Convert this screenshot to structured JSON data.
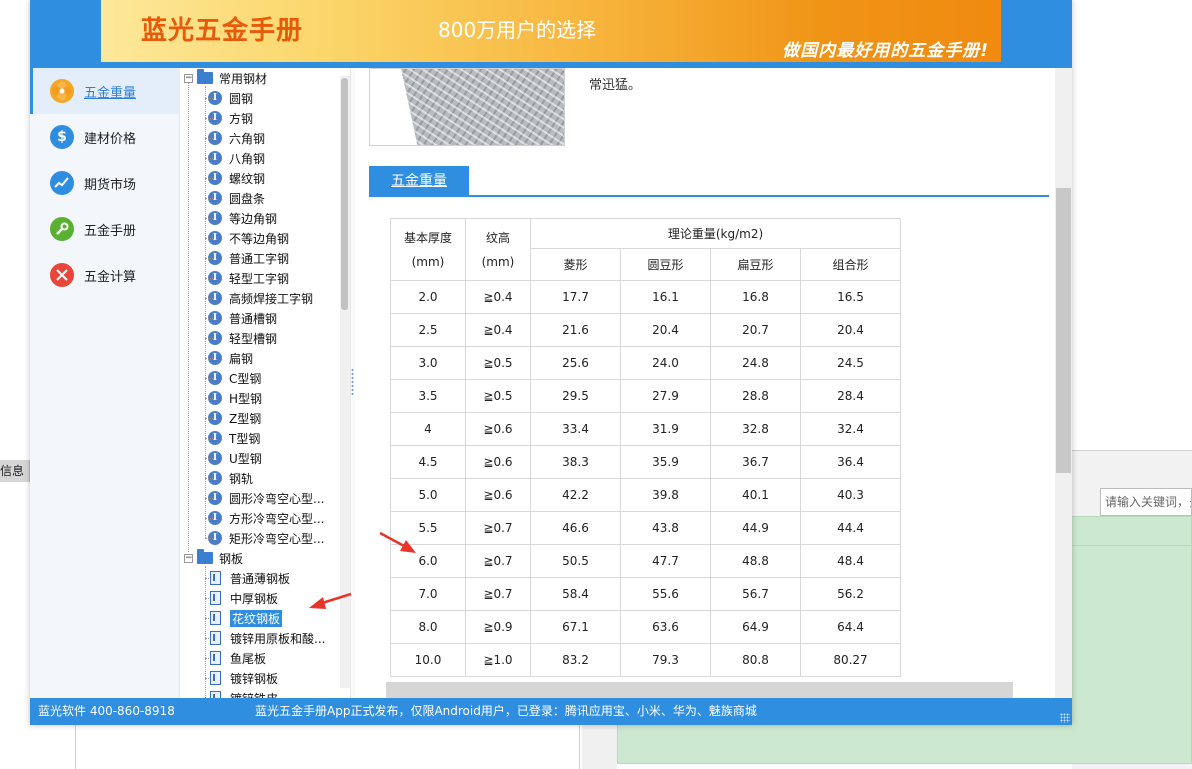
{
  "background": {
    "left_tab_text": "信息",
    "right_search_placeholder": "请输入关键词，多"
  },
  "banner": {
    "title": "蓝光五金手册",
    "subtitle": "800万用户的选择",
    "slogan": "做国内最好用的五金手册!"
  },
  "nav": {
    "items": [
      {
        "label": "五金重量",
        "icon": "flower-icon",
        "color": "#f5a623",
        "active": true
      },
      {
        "label": "建材价格",
        "icon": "dollar-icon",
        "color": "#2f8ee0",
        "active": false
      },
      {
        "label": "期货市场",
        "icon": "trend-chart-icon",
        "color": "#2f8ee0",
        "active": false
      },
      {
        "label": "五金手册",
        "icon": "wrench-icon",
        "color": "#5ab030",
        "active": false
      },
      {
        "label": "五金计算",
        "icon": "tools-icon",
        "color": "#e8463a",
        "active": false
      }
    ]
  },
  "tree": {
    "group1": "常用钢材",
    "group1_items": [
      "圆钢",
      "方钢",
      "六角钢",
      "八角钢",
      "螺纹钢",
      "圆盘条",
      "等边角钢",
      "不等边角钢",
      "普通工字钢",
      "轻型工字钢",
      "高频焊接工字钢",
      "普通槽钢",
      "轻型槽钢",
      "扁钢",
      "C型钢",
      "H型钢",
      "Z型钢",
      "T型钢",
      "U型钢",
      "钢轨",
      "圆形冷弯空心型...",
      "方形冷弯空心型...",
      "矩形冷弯空心型..."
    ],
    "group2": "钢板",
    "group2_items": [
      "普通薄钢板",
      "中厚钢板",
      "花纹钢板",
      "镀锌用原板和酸...",
      "鱼尾板",
      "镀锌钢板",
      "镀锌铁皮"
    ],
    "selected": "花纹钢板"
  },
  "content": {
    "desc_tail": "常迅猛。",
    "section_tab": "五金重量",
    "table": {
      "h_thickness": "基本厚度",
      "h_thickness_unit": "(mm)",
      "h_pattern": "纹高",
      "h_pattern_unit": "(mm)",
      "h_weight": "理论重量(kg/m2)",
      "sub_headers": [
        "菱形",
        "圆豆形",
        "扁豆形",
        "组合形"
      ],
      "rows": [
        [
          "2.0",
          "≧0.4",
          "17.7",
          "16.1",
          "16.8",
          "16.5"
        ],
        [
          "2.5",
          "≧0.4",
          "21.6",
          "20.4",
          "20.7",
          "20.4"
        ],
        [
          "3.0",
          "≧0.5",
          "25.6",
          "24.0",
          "24.8",
          "24.5"
        ],
        [
          "3.5",
          "≧0.5",
          "29.5",
          "27.9",
          "28.8",
          "28.4"
        ],
        [
          "4",
          "≧0.6",
          "33.4",
          "31.9",
          "32.8",
          "32.4"
        ],
        [
          "4.5",
          "≧0.6",
          "38.3",
          "35.9",
          "36.7",
          "36.4"
        ],
        [
          "5.0",
          "≧0.6",
          "42.2",
          "39.8",
          "40.1",
          "40.3"
        ],
        [
          "5.5",
          "≧0.7",
          "46.6",
          "43.8",
          "44.9",
          "44.4"
        ],
        [
          "6.0",
          "≧0.7",
          "50.5",
          "47.7",
          "48.8",
          "48.4"
        ],
        [
          "7.0",
          "≧0.7",
          "58.4",
          "55.6",
          "56.7",
          "56.2"
        ],
        [
          "8.0",
          "≧0.9",
          "67.1",
          "63.6",
          "64.9",
          "64.4"
        ],
        [
          "10.0",
          "≧1.0",
          "83.2",
          "79.3",
          "80.8",
          "80.27"
        ]
      ]
    }
  },
  "status": {
    "left": "蓝光软件 400-860-8918",
    "message": "蓝光五金手册App正式发布，仅限Android用户，已登录：腾讯应用宝、小米、华为、魅族商城"
  },
  "colors": {
    "accent": "#2f8ee0",
    "arrow": "#e8352a"
  }
}
